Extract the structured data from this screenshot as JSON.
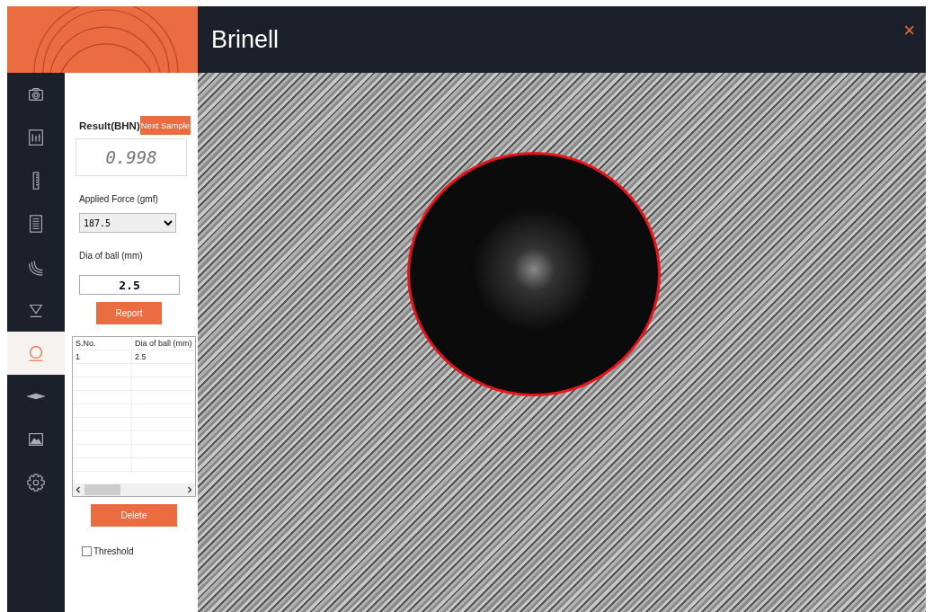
{
  "window": {
    "title": "Brinell",
    "close": "×"
  },
  "sidebar": {
    "items": [
      {
        "selected": false
      },
      {
        "selected": false
      },
      {
        "selected": false
      },
      {
        "selected": false
      },
      {
        "selected": false
      },
      {
        "selected": false
      },
      {
        "selected": true
      },
      {
        "selected": false
      },
      {
        "selected": false
      },
      {
        "selected": false
      }
    ]
  },
  "panel": {
    "result_label": "Result(BHN)",
    "next_sample": "Next Sample",
    "result_value": "0.998",
    "applied_force_label": "Applied Force (gmf)",
    "applied_force": "187.5",
    "dia_label": "Dia of ball (mm)",
    "dia_value": "2.5",
    "report": "Report",
    "table": {
      "columns": [
        "S.No.",
        "Dia of ball (mm)"
      ],
      "rows": [
        [
          "1",
          "2.5"
        ]
      ]
    },
    "delete": "Delete",
    "threshold": {
      "label": "Threshold",
      "checked": false
    }
  }
}
